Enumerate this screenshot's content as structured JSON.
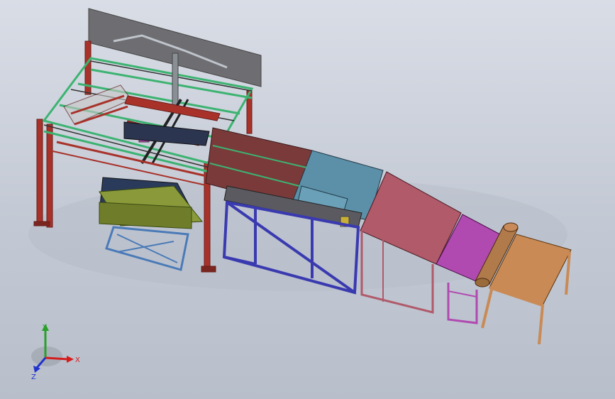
{
  "triad": {
    "x_label": "X",
    "y_label": "Y",
    "z_label": "Z",
    "x_color": "#d41e1e",
    "y_color": "#2aa02a",
    "z_color": "#2233cc"
  },
  "colors": {
    "background_top": "#d9dde6",
    "background_bottom": "#b8bfcb",
    "frame_red": "#a8322a",
    "frame_green": "#3cb371",
    "conveyor_maroon": "#7a3a3a",
    "conveyor_teal": "#5b90a8",
    "conveyor_frame_blue": "#3a3ab0",
    "ramp_rose": "#b05a6a",
    "ramp_magenta": "#b04ab0",
    "table_tan": "#c98a55",
    "roller_brown": "#b07a4a",
    "platform_olive": "#8a9a3a",
    "lift_blue": "#4a7ab8"
  }
}
